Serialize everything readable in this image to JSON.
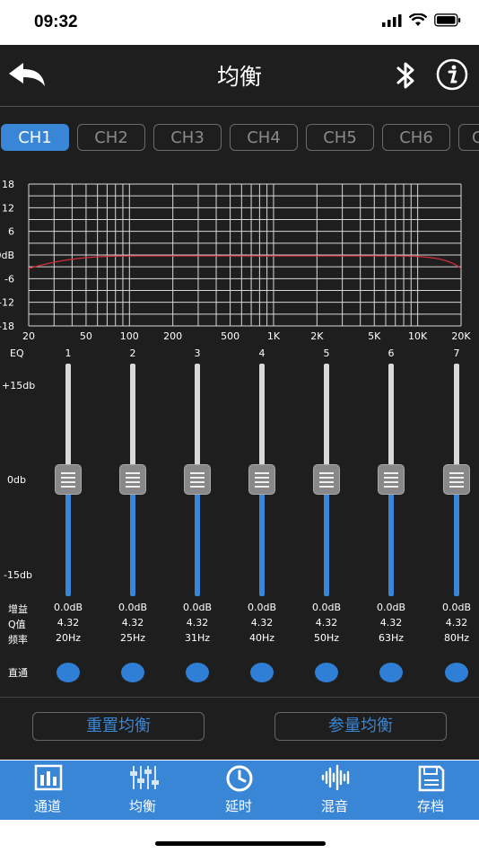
{
  "status": {
    "time": "09:32"
  },
  "nav": {
    "title": "均衡"
  },
  "channels": [
    "CH1",
    "CH2",
    "CH3",
    "CH4",
    "CH5",
    "CH6",
    "C"
  ],
  "active_channel": "CH1",
  "graph": {
    "y_labels": [
      "18",
      "12",
      "6",
      "0dB",
      "-6",
      "-12",
      "-18"
    ],
    "x_labels": [
      "20",
      "50",
      "100",
      "200",
      "500",
      "1K",
      "2K",
      "5K",
      "10K",
      "20K"
    ]
  },
  "eq": {
    "row_label": "EQ",
    "scale": {
      "top": "+15db",
      "mid": "0db",
      "bottom": "-15db"
    },
    "gain_label": "增益",
    "q_label": "Q值",
    "freq_label": "频率",
    "bypass_label": "直通",
    "bands": [
      {
        "num": "1",
        "gain": "0.0dB",
        "q": "4.32",
        "freq": "20Hz"
      },
      {
        "num": "2",
        "gain": "0.0dB",
        "q": "4.32",
        "freq": "25Hz"
      },
      {
        "num": "3",
        "gain": "0.0dB",
        "q": "4.32",
        "freq": "31Hz"
      },
      {
        "num": "4",
        "gain": "0.0dB",
        "q": "4.32",
        "freq": "40Hz"
      },
      {
        "num": "5",
        "gain": "0.0dB",
        "q": "4.32",
        "freq": "50Hz"
      },
      {
        "num": "6",
        "gain": "0.0dB",
        "q": "4.32",
        "freq": "63Hz"
      },
      {
        "num": "7",
        "gain": "0.0dB",
        "q": "4.32",
        "freq": "80Hz"
      }
    ]
  },
  "actions": {
    "reset": "重置均衡",
    "param": "参量均衡"
  },
  "tabbar": [
    {
      "label": "通道",
      "icon": "channel-icon"
    },
    {
      "label": "均衡",
      "icon": "equalizer-icon"
    },
    {
      "label": "延时",
      "icon": "clock-icon"
    },
    {
      "label": "混音",
      "icon": "waveform-icon"
    },
    {
      "label": "存档",
      "icon": "save-icon"
    }
  ],
  "colors": {
    "accent": "#3a86d6",
    "curve": "#d0303a",
    "background": "#1e1e1e"
  }
}
